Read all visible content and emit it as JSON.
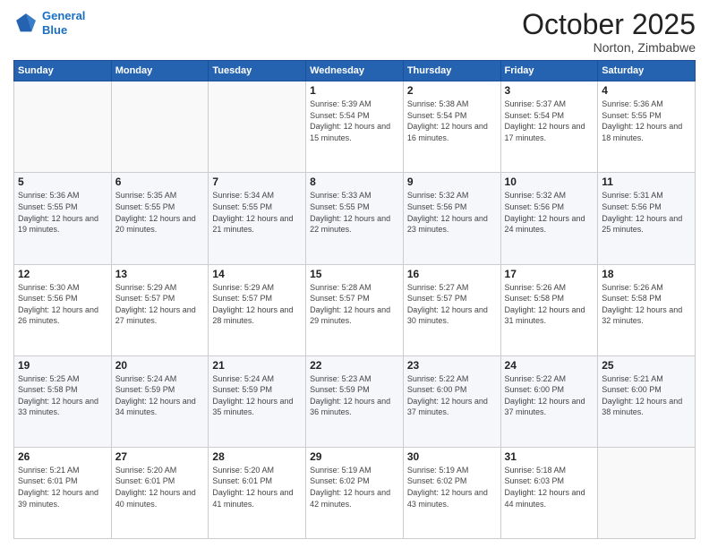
{
  "header": {
    "logo_line1": "General",
    "logo_line2": "Blue",
    "month": "October 2025",
    "location": "Norton, Zimbabwe"
  },
  "weekdays": [
    "Sunday",
    "Monday",
    "Tuesday",
    "Wednesday",
    "Thursday",
    "Friday",
    "Saturday"
  ],
  "weeks": [
    [
      {
        "day": "",
        "sunrise": "",
        "sunset": "",
        "daylight": ""
      },
      {
        "day": "",
        "sunrise": "",
        "sunset": "",
        "daylight": ""
      },
      {
        "day": "",
        "sunrise": "",
        "sunset": "",
        "daylight": ""
      },
      {
        "day": "1",
        "sunrise": "Sunrise: 5:39 AM",
        "sunset": "Sunset: 5:54 PM",
        "daylight": "Daylight: 12 hours and 15 minutes."
      },
      {
        "day": "2",
        "sunrise": "Sunrise: 5:38 AM",
        "sunset": "Sunset: 5:54 PM",
        "daylight": "Daylight: 12 hours and 16 minutes."
      },
      {
        "day": "3",
        "sunrise": "Sunrise: 5:37 AM",
        "sunset": "Sunset: 5:54 PM",
        "daylight": "Daylight: 12 hours and 17 minutes."
      },
      {
        "day": "4",
        "sunrise": "Sunrise: 5:36 AM",
        "sunset": "Sunset: 5:55 PM",
        "daylight": "Daylight: 12 hours and 18 minutes."
      }
    ],
    [
      {
        "day": "5",
        "sunrise": "Sunrise: 5:36 AM",
        "sunset": "Sunset: 5:55 PM",
        "daylight": "Daylight: 12 hours and 19 minutes."
      },
      {
        "day": "6",
        "sunrise": "Sunrise: 5:35 AM",
        "sunset": "Sunset: 5:55 PM",
        "daylight": "Daylight: 12 hours and 20 minutes."
      },
      {
        "day": "7",
        "sunrise": "Sunrise: 5:34 AM",
        "sunset": "Sunset: 5:55 PM",
        "daylight": "Daylight: 12 hours and 21 minutes."
      },
      {
        "day": "8",
        "sunrise": "Sunrise: 5:33 AM",
        "sunset": "Sunset: 5:55 PM",
        "daylight": "Daylight: 12 hours and 22 minutes."
      },
      {
        "day": "9",
        "sunrise": "Sunrise: 5:32 AM",
        "sunset": "Sunset: 5:56 PM",
        "daylight": "Daylight: 12 hours and 23 minutes."
      },
      {
        "day": "10",
        "sunrise": "Sunrise: 5:32 AM",
        "sunset": "Sunset: 5:56 PM",
        "daylight": "Daylight: 12 hours and 24 minutes."
      },
      {
        "day": "11",
        "sunrise": "Sunrise: 5:31 AM",
        "sunset": "Sunset: 5:56 PM",
        "daylight": "Daylight: 12 hours and 25 minutes."
      }
    ],
    [
      {
        "day": "12",
        "sunrise": "Sunrise: 5:30 AM",
        "sunset": "Sunset: 5:56 PM",
        "daylight": "Daylight: 12 hours and 26 minutes."
      },
      {
        "day": "13",
        "sunrise": "Sunrise: 5:29 AM",
        "sunset": "Sunset: 5:57 PM",
        "daylight": "Daylight: 12 hours and 27 minutes."
      },
      {
        "day": "14",
        "sunrise": "Sunrise: 5:29 AM",
        "sunset": "Sunset: 5:57 PM",
        "daylight": "Daylight: 12 hours and 28 minutes."
      },
      {
        "day": "15",
        "sunrise": "Sunrise: 5:28 AM",
        "sunset": "Sunset: 5:57 PM",
        "daylight": "Daylight: 12 hours and 29 minutes."
      },
      {
        "day": "16",
        "sunrise": "Sunrise: 5:27 AM",
        "sunset": "Sunset: 5:57 PM",
        "daylight": "Daylight: 12 hours and 30 minutes."
      },
      {
        "day": "17",
        "sunrise": "Sunrise: 5:26 AM",
        "sunset": "Sunset: 5:58 PM",
        "daylight": "Daylight: 12 hours and 31 minutes."
      },
      {
        "day": "18",
        "sunrise": "Sunrise: 5:26 AM",
        "sunset": "Sunset: 5:58 PM",
        "daylight": "Daylight: 12 hours and 32 minutes."
      }
    ],
    [
      {
        "day": "19",
        "sunrise": "Sunrise: 5:25 AM",
        "sunset": "Sunset: 5:58 PM",
        "daylight": "Daylight: 12 hours and 33 minutes."
      },
      {
        "day": "20",
        "sunrise": "Sunrise: 5:24 AM",
        "sunset": "Sunset: 5:59 PM",
        "daylight": "Daylight: 12 hours and 34 minutes."
      },
      {
        "day": "21",
        "sunrise": "Sunrise: 5:24 AM",
        "sunset": "Sunset: 5:59 PM",
        "daylight": "Daylight: 12 hours and 35 minutes."
      },
      {
        "day": "22",
        "sunrise": "Sunrise: 5:23 AM",
        "sunset": "Sunset: 5:59 PM",
        "daylight": "Daylight: 12 hours and 36 minutes."
      },
      {
        "day": "23",
        "sunrise": "Sunrise: 5:22 AM",
        "sunset": "Sunset: 6:00 PM",
        "daylight": "Daylight: 12 hours and 37 minutes."
      },
      {
        "day": "24",
        "sunrise": "Sunrise: 5:22 AM",
        "sunset": "Sunset: 6:00 PM",
        "daylight": "Daylight: 12 hours and 37 minutes."
      },
      {
        "day": "25",
        "sunrise": "Sunrise: 5:21 AM",
        "sunset": "Sunset: 6:00 PM",
        "daylight": "Daylight: 12 hours and 38 minutes."
      }
    ],
    [
      {
        "day": "26",
        "sunrise": "Sunrise: 5:21 AM",
        "sunset": "Sunset: 6:01 PM",
        "daylight": "Daylight: 12 hours and 39 minutes."
      },
      {
        "day": "27",
        "sunrise": "Sunrise: 5:20 AM",
        "sunset": "Sunset: 6:01 PM",
        "daylight": "Daylight: 12 hours and 40 minutes."
      },
      {
        "day": "28",
        "sunrise": "Sunrise: 5:20 AM",
        "sunset": "Sunset: 6:01 PM",
        "daylight": "Daylight: 12 hours and 41 minutes."
      },
      {
        "day": "29",
        "sunrise": "Sunrise: 5:19 AM",
        "sunset": "Sunset: 6:02 PM",
        "daylight": "Daylight: 12 hours and 42 minutes."
      },
      {
        "day": "30",
        "sunrise": "Sunrise: 5:19 AM",
        "sunset": "Sunset: 6:02 PM",
        "daylight": "Daylight: 12 hours and 43 minutes."
      },
      {
        "day": "31",
        "sunrise": "Sunrise: 5:18 AM",
        "sunset": "Sunset: 6:03 PM",
        "daylight": "Daylight: 12 hours and 44 minutes."
      },
      {
        "day": "",
        "sunrise": "",
        "sunset": "",
        "daylight": ""
      }
    ]
  ]
}
